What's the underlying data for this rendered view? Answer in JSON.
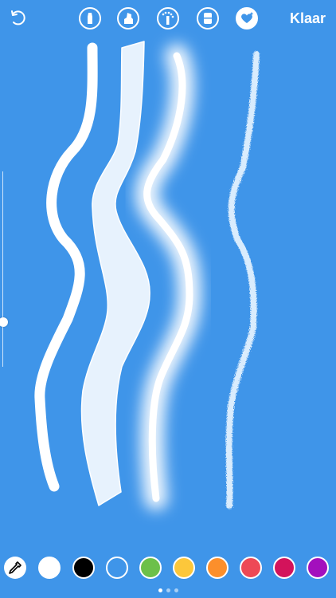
{
  "header": {
    "done_label": "Klaar",
    "undo_icon": "undo-icon",
    "tools": [
      {
        "name": "pen",
        "icon": "pen-icon",
        "selected": false
      },
      {
        "name": "marker",
        "icon": "marker-icon",
        "selected": false
      },
      {
        "name": "neon",
        "icon": "neon-icon",
        "selected": false
      },
      {
        "name": "eraser",
        "icon": "eraser-icon",
        "selected": false
      },
      {
        "name": "heart",
        "icon": "heart-icon",
        "selected": true
      }
    ]
  },
  "brush_size": 0.77,
  "colors": {
    "background": "#3f95e9",
    "palette": [
      "#ffffff",
      "#000000",
      "#3f95e9",
      "#6cc04a",
      "#fcc73b",
      "#fc8f2b",
      "#ed4956",
      "#d3135b",
      "#a30fbd"
    ]
  },
  "pagination": {
    "pages": 3,
    "active": 1
  }
}
